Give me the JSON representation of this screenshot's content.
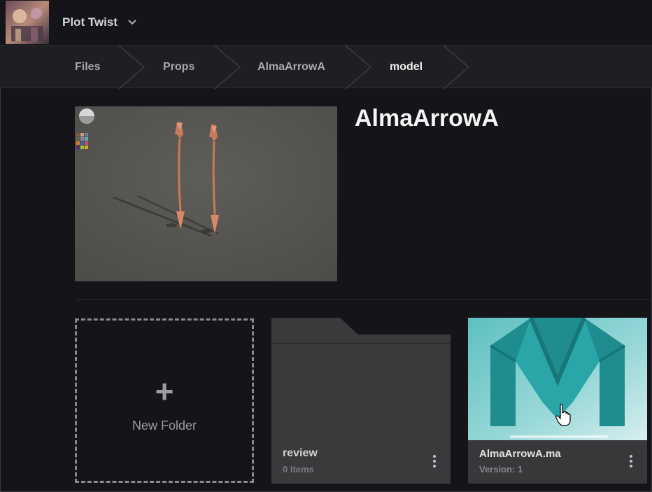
{
  "header": {
    "project_name": "Plot Twist",
    "project_thumbnail": "project-thumbnail-image",
    "dropdown_icon": "chevron-down-icon"
  },
  "breadcrumb": {
    "items": [
      {
        "label": "Files"
      },
      {
        "label": "Props"
      },
      {
        "label": "AlmaArrowA"
      },
      {
        "label": "model",
        "active": true
      }
    ]
  },
  "asset": {
    "title": "AlmaArrowA",
    "preview": "3d-arrow-model-preview"
  },
  "cards": {
    "new_folder": {
      "icon": "plus-icon",
      "label": "New Folder"
    },
    "folder": {
      "name": "review",
      "count": "0 Items",
      "menu_icon": "more-vertical-icon"
    },
    "file": {
      "name": "AlmaArrowA.ma",
      "version": "Version: 1",
      "thumbnail": "maya-logo-thumbnail",
      "menu_icon": "more-vertical-icon"
    }
  },
  "colors": {
    "background": "#151519",
    "breadcrumb_bg": "#1f1f23",
    "card_bg": "#38383b",
    "maya_teal": "#2aa6a8"
  }
}
